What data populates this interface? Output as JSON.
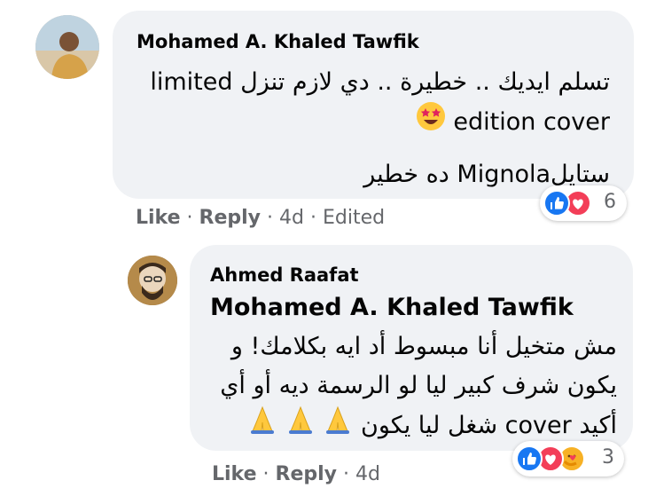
{
  "comment1": {
    "author": "Mohamed A. Khaled Tawfik",
    "line1": "تسلم ايديك .. خطيرة .. دي لازم تنزل limited",
    "line2": "edition cover",
    "line3": "ستايلMignola ده خطير",
    "like_label": "Like",
    "reply_label": "Reply",
    "time": "4d",
    "edited": "Edited",
    "reaction_count": "6",
    "reactions": [
      "like-icon",
      "love-icon"
    ]
  },
  "comment2": {
    "author": "Ahmed Raafat",
    "mention": "Mohamed A. Khaled Tawfik",
    "line1": "مش متخيل أنا مبسوط أد ايه بكلامك! و",
    "line2": "يكون شرف كبير ليا لو الرسمة ديه أو أي",
    "line3": "أكيد cover شغل ليا يكون",
    "like_label": "Like",
    "reply_label": "Reply",
    "time": "4d",
    "reaction_count": "3",
    "reactions": [
      "like-icon",
      "love-icon",
      "care-icon"
    ]
  },
  "colors": {
    "like": "#1877f2",
    "love": "#f33e58",
    "care": "#f7b125",
    "bubble": "#f0f2f5",
    "meta": "#65676b"
  }
}
